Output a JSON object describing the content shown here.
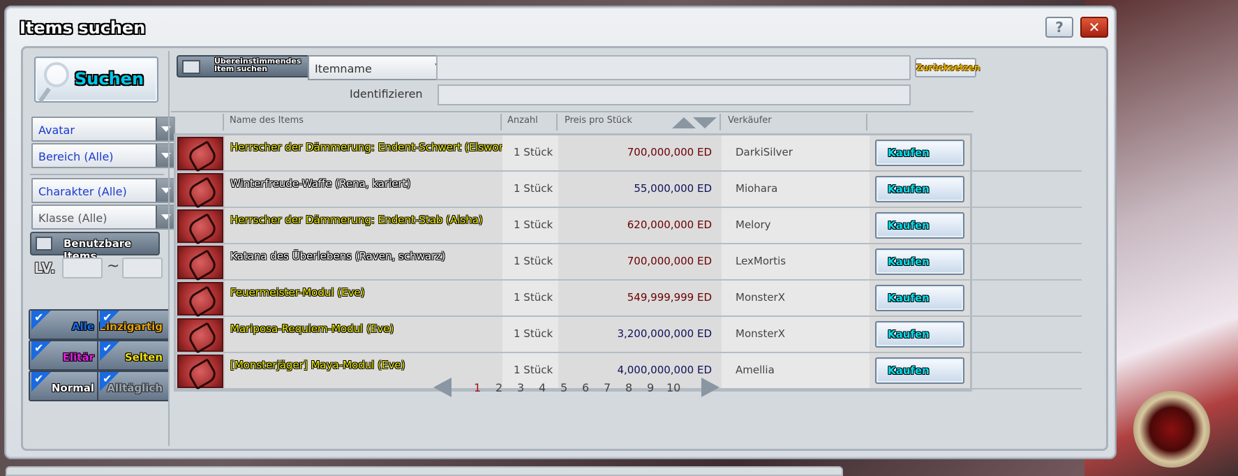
{
  "window": {
    "title": "Items suchen",
    "help_icon": "question-icon",
    "close_icon": "close-icon"
  },
  "left": {
    "search_label": "Suchen",
    "dropdowns": [
      "Avatar",
      "Bereich (Alle)",
      "Charakter (Alle)",
      "Klasse (Alle)"
    ],
    "usable_items_label": "Benutzbare Items",
    "level_label": "LV.",
    "level_separator": "~",
    "level_min": "",
    "level_max": "",
    "filters": [
      "Alle",
      "Einzigartig",
      "Elitär",
      "Selten",
      "Normal",
      "Alltäglich"
    ]
  },
  "search": {
    "match_label_line1": "Übereinstimmendes",
    "match_label_line2": "Item suchen",
    "field_select": "Itemname",
    "query": "",
    "reset_label": "Zurücksetzen",
    "identify_label": "Identifizieren",
    "identify_value": ""
  },
  "table": {
    "headers": {
      "name": "Name des Items",
      "qty": "Anzahl",
      "price": "Preis pro Stück",
      "seller": "Verkäufer"
    },
    "buy_label": "Kaufen",
    "rows": [
      {
        "name": "Herrscher der Dämmerung: Endent-Schwert (Elsword)",
        "qty": "1 Stück",
        "price": "700,000,000 ED",
        "seller": "DarkiSilver",
        "name_color": "yellow",
        "price_color": "red"
      },
      {
        "name": "Winterfreude-Waffe (Rena, kariert)",
        "qty": "1 Stück",
        "price": "55,000,000 ED",
        "seller": "Miohara",
        "name_color": "white",
        "price_color": "blue"
      },
      {
        "name": "Herrscher der Dämmerung: Endent-Stab (Aisha)",
        "qty": "1 Stück",
        "price": "620,000,000 ED",
        "seller": "Melory",
        "name_color": "yellow",
        "price_color": "red"
      },
      {
        "name": "Katana des Überlebens (Raven, schwarz)",
        "qty": "1 Stück",
        "price": "700,000,000 ED",
        "seller": "LexMortis",
        "name_color": "white",
        "price_color": "red"
      },
      {
        "name": "Feuermeister-Modul (Eve)",
        "qty": "1 Stück",
        "price": "549,999,999 ED",
        "seller": "MonsterX",
        "name_color": "yellow",
        "price_color": "red"
      },
      {
        "name": "Mariposa-Requiem-Modul (Eve)",
        "qty": "1 Stück",
        "price": "3,200,000,000 ED",
        "seller": "MonsterX",
        "name_color": "yellow",
        "price_color": "blue"
      },
      {
        "name": "[Monsterjäger] Maya-Modul (Eve)",
        "qty": "1 Stück",
        "price": "4,000,000,000 ED",
        "seller": "Amellia",
        "name_color": "yellow",
        "price_color": "blue"
      }
    ]
  },
  "pagination": {
    "pages": [
      "1",
      "2",
      "3",
      "4",
      "5",
      "6",
      "7",
      "8",
      "9",
      "10"
    ],
    "current": "1"
  }
}
